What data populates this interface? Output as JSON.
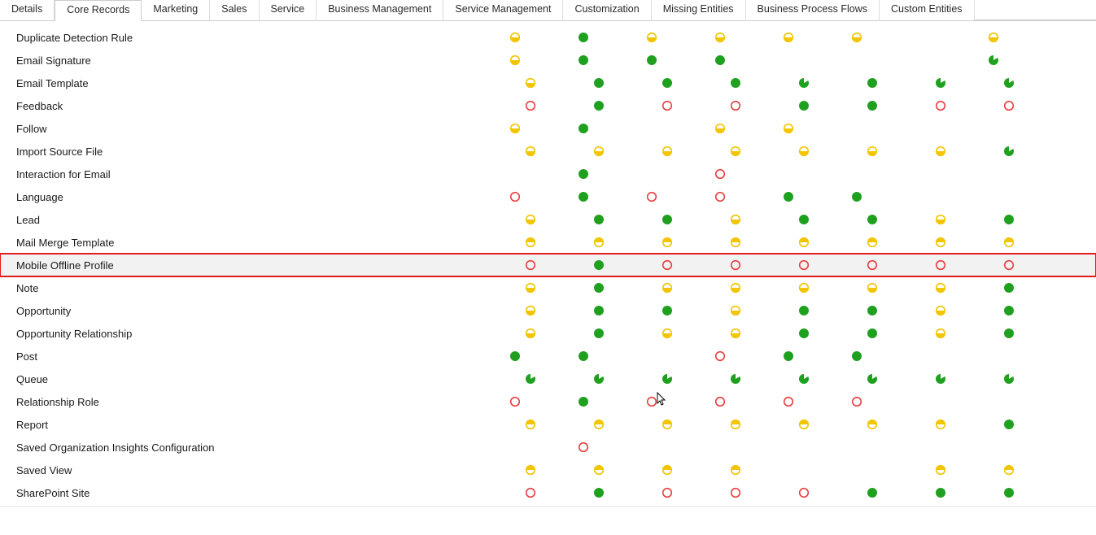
{
  "tabs": [
    {
      "id": "details",
      "label": "Details"
    },
    {
      "id": "core",
      "label": "Core Records",
      "active": true
    },
    {
      "id": "marketing",
      "label": "Marketing"
    },
    {
      "id": "sales",
      "label": "Sales"
    },
    {
      "id": "service",
      "label": "Service"
    },
    {
      "id": "bizmgmt",
      "label": "Business Management"
    },
    {
      "id": "svcmgmt",
      "label": "Service Management"
    },
    {
      "id": "custom",
      "label": "Customization"
    },
    {
      "id": "missing",
      "label": "Missing Entities"
    },
    {
      "id": "bpf",
      "label": "Business Process Flows"
    },
    {
      "id": "ce",
      "label": "Custom Entities"
    }
  ],
  "icon_legend": {
    "n": "none (red empty circle)",
    "o": "organization / full (solid green circle)",
    "u": "user / partial bottom (yellow bottom-half)",
    "bu": "business-unit (yellow top-half)",
    "pc": "parent-child BU (green circle with white notch)",
    "": "blank"
  },
  "entities": [
    {
      "name": "Duplicate Detection Rule",
      "perm": [
        "u",
        "o",
        "u",
        "u",
        "u",
        "u",
        "",
        "u",
        ""
      ]
    },
    {
      "name": "Email Signature",
      "perm": [
        "u",
        "o",
        "o",
        "o",
        "",
        "",
        "",
        "pc",
        ""
      ]
    },
    {
      "name": "Email Template",
      "perm": [
        "u",
        "o",
        "o",
        "o",
        "pc",
        "o",
        "pc",
        "pc"
      ]
    },
    {
      "name": "Feedback",
      "perm": [
        "n",
        "o",
        "n",
        "n",
        "o",
        "o",
        "n",
        "n"
      ]
    },
    {
      "name": "Follow",
      "perm": [
        "u",
        "o",
        "",
        "u",
        "u",
        "",
        "",
        "",
        ""
      ]
    },
    {
      "name": "Import Source File",
      "perm": [
        "u",
        "u",
        "u",
        "u",
        "u",
        "u",
        "u",
        "pc"
      ]
    },
    {
      "name": "Interaction for Email",
      "perm": [
        "",
        "o",
        "",
        "n",
        "",
        "",
        "",
        "",
        ""
      ]
    },
    {
      "name": "Language",
      "perm": [
        "n",
        "o",
        "n",
        "n",
        "o",
        "o",
        "",
        "",
        ""
      ]
    },
    {
      "name": "Lead",
      "perm": [
        "u",
        "o",
        "o",
        "u",
        "o",
        "o",
        "u",
        "o"
      ]
    },
    {
      "name": "Mail Merge Template",
      "perm": [
        "bu",
        "bu",
        "bu",
        "bu",
        "bu",
        "bu",
        "bu",
        "bu"
      ]
    },
    {
      "name": "Mobile Offline Profile",
      "selected": true,
      "perm": [
        "n",
        "o",
        "n",
        "n",
        "n",
        "n",
        "n",
        "n"
      ]
    },
    {
      "name": "Note",
      "perm": [
        "u",
        "o",
        "u",
        "u",
        "u",
        "u",
        "u",
        "o"
      ]
    },
    {
      "name": "Opportunity",
      "perm": [
        "u",
        "o",
        "o",
        "u",
        "o",
        "o",
        "u",
        "o"
      ]
    },
    {
      "name": "Opportunity Relationship",
      "perm": [
        "u",
        "o",
        "u",
        "u",
        "o",
        "o",
        "u",
        "o"
      ]
    },
    {
      "name": "Post",
      "perm": [
        "o",
        "o",
        "",
        "n",
        "o",
        "o",
        "",
        "",
        ""
      ]
    },
    {
      "name": "Queue",
      "perm": [
        "pc",
        "pc",
        "pc",
        "pc",
        "pc",
        "pc",
        "pc",
        "pc"
      ]
    },
    {
      "name": "Relationship Role",
      "perm": [
        "n",
        "o",
        "n",
        "n",
        "n",
        "n",
        "",
        "",
        ""
      ]
    },
    {
      "name": "Report",
      "perm": [
        "bu",
        "bu",
        "bu",
        "bu",
        "bu",
        "bu",
        "bu",
        "o"
      ]
    },
    {
      "name": "Saved Organization Insights Configuration",
      "perm": [
        "",
        "n",
        "",
        "",
        "",
        "",
        "",
        "",
        ""
      ]
    },
    {
      "name": "Saved View",
      "perm": [
        "bu",
        "bu",
        "bu",
        "bu",
        "",
        "",
        "bu",
        "bu"
      ]
    },
    {
      "name": "SharePoint Site",
      "perm": [
        "n",
        "o",
        "n",
        "n",
        "n",
        "o",
        "o",
        "o"
      ]
    }
  ],
  "colors": {
    "green": "#1fa01f",
    "yellow": "#f2c500",
    "red": "#e74040",
    "select": "#e11c1c"
  }
}
